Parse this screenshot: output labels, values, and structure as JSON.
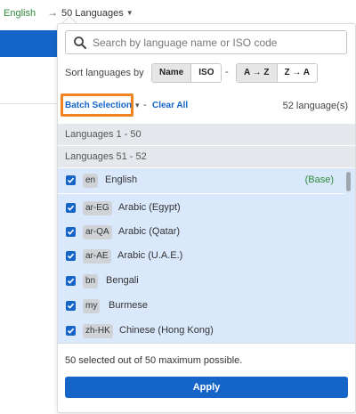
{
  "top": {
    "current_language": "English",
    "languages_dropdown_label": "50 Languages"
  },
  "search": {
    "placeholder": "Search by language name or ISO code",
    "value": ""
  },
  "sort": {
    "label": "Sort languages by",
    "by_options": [
      "Name",
      "ISO"
    ],
    "by_selected": "Name",
    "separator": "-",
    "order_options": [
      "A → Z",
      "Z → A"
    ],
    "order_selected": "A → Z"
  },
  "batch": {
    "batch_label": "Batch Selection",
    "separator": "-",
    "clear_label": "Clear All",
    "count_label": "52 language(s)"
  },
  "groups": [
    "Languages 1 - 50",
    "Languages 51 - 52"
  ],
  "languages": [
    {
      "code": "en",
      "name": "English",
      "checked": true,
      "tag": "(Base)"
    },
    {
      "code": "ar-EG",
      "name": "Arabic (Egypt)",
      "checked": true
    },
    {
      "code": "ar-QA",
      "name": "Arabic (Qatar)",
      "checked": true
    },
    {
      "code": "ar-AE",
      "name": "Arabic (U.A.E.)",
      "checked": true
    },
    {
      "code": "bn",
      "name": "Bengali",
      "checked": true
    },
    {
      "code": "my",
      "name": "Burmese",
      "checked": true
    },
    {
      "code": "zh-HK",
      "name": "Chinese (Hong Kong)",
      "checked": true
    }
  ],
  "footer": {
    "status": "50 selected out of 50 maximum possible.",
    "apply_label": "Apply"
  },
  "colors": {
    "accent": "#1565c9",
    "highlight_border": "#f0831e",
    "list_bg": "#d9e8fb",
    "base_tag": "#2e8b3a"
  }
}
